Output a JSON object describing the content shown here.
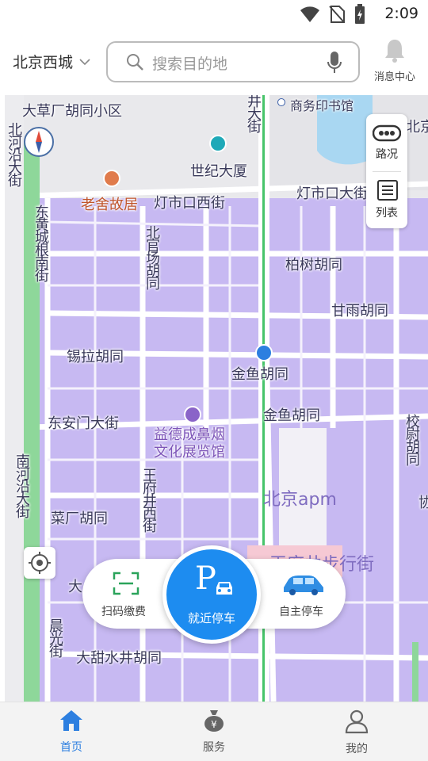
{
  "status": {
    "time": "2:09"
  },
  "header": {
    "city": "北京西城",
    "search_placeholder": "搜索目的地",
    "message_center": "消息中心"
  },
  "map": {
    "labels": {
      "dacaochang": "大草厂胡同小区",
      "jingdajie": "井大街",
      "commercial_press": "商务印书馆",
      "beijing_edge": "北京",
      "beiheyan": "北河沿大街",
      "century_mansion": "世纪大厦",
      "laoshe": "老舍故居",
      "dengshikou_west": "灯市口西街",
      "dengshikou_big": "灯市口大街",
      "donghuangcheng": "东黄城根南街",
      "beiguanchang": "北官场胡同",
      "baishu": "柏树胡同",
      "ganyu": "甘雨胡同",
      "xila": "锡拉胡同",
      "jinyu_1": "金鱼胡同",
      "dongan": "东安门大街",
      "jinyu_2": "金鱼胡同",
      "snuff_museum": "益德成鼻烟文化展览馆",
      "xiaowei": "校尉胡同",
      "apm": "北京apm",
      "nanheyan": "南河沿大街",
      "caichang": "菜厂胡同",
      "wangfujing_west": "王府井西街",
      "xie": "协",
      "walking_street": "王府井步行街",
      "da": "大",
      "chenguang": "晨光街",
      "datianshuijing": "大甜水井胡同"
    },
    "side_panel": {
      "traffic": "路况",
      "list": "列表"
    }
  },
  "actions": {
    "scan_pay": "扫码缴费",
    "nearby_parking": "就近停车",
    "self_parking": "自主停车",
    "parking_letter": "P"
  },
  "tabbar": {
    "home": "首页",
    "service": "服务",
    "mine": "我的",
    "active_tab": "首页"
  },
  "colors": {
    "accent": "#1d8cf0",
    "tab_active": "#2d7fe0",
    "map_block": "#c7b9f2",
    "scan_icon": "#2aa35a"
  }
}
